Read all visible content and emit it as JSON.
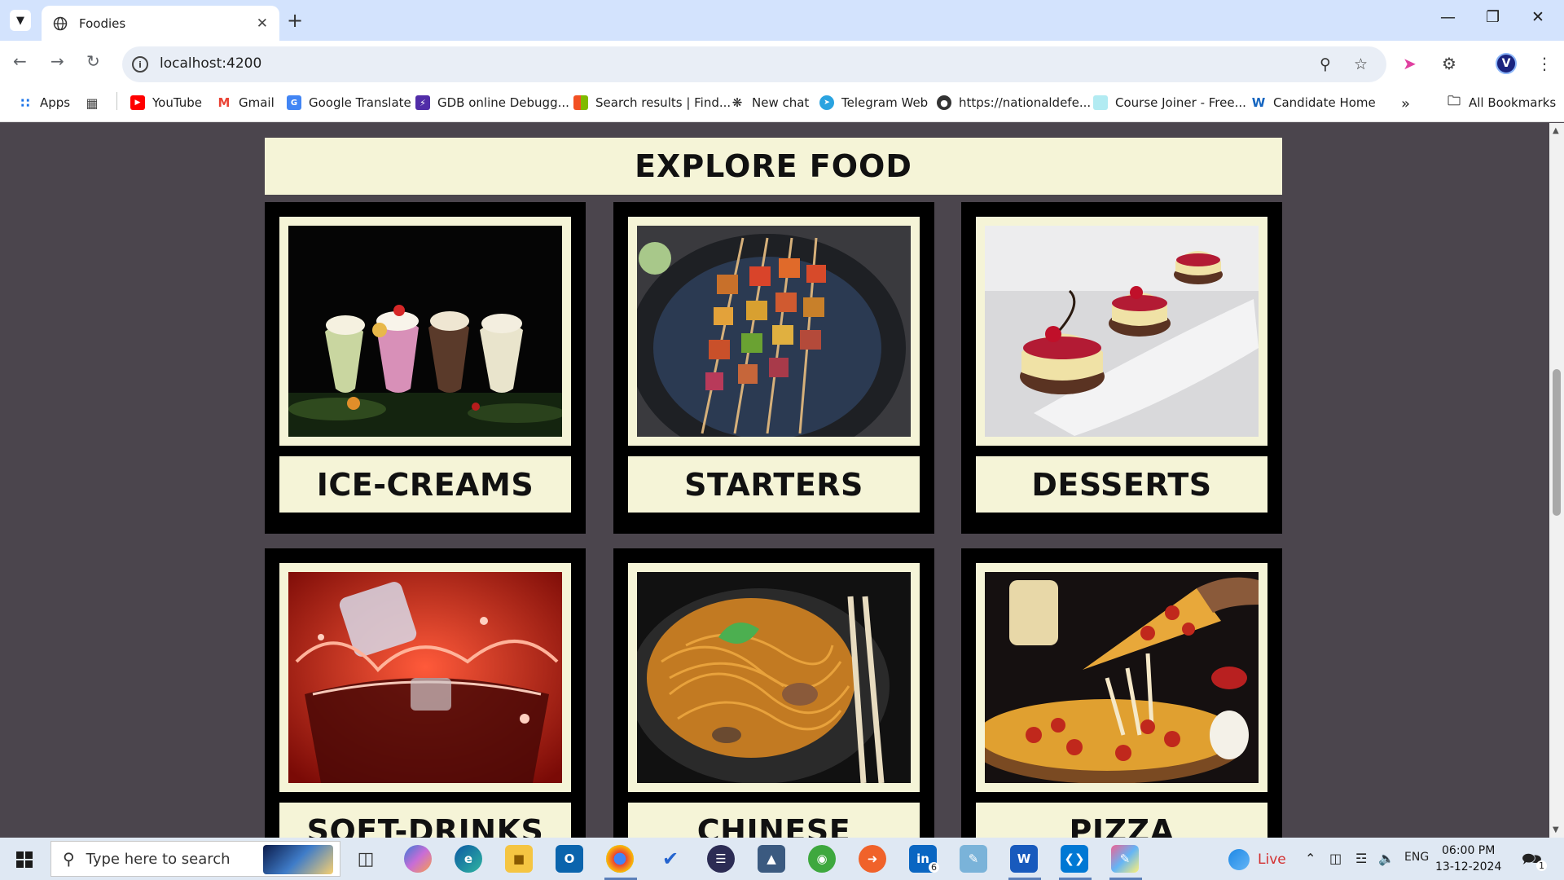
{
  "browser": {
    "tab_title": "Foodies",
    "url": "localhost:4200",
    "bookmarks": [
      {
        "label": "Apps",
        "icon": "apps-grid-icon"
      },
      {
        "label": "YouTube",
        "icon": "youtube-icon"
      },
      {
        "label": "Gmail",
        "icon": "gmail-icon"
      },
      {
        "label": "Google Translate",
        "icon": "translate-icon"
      },
      {
        "label": "GDB online Debugg...",
        "icon": "gdb-icon"
      },
      {
        "label": "Search results | Find...",
        "icon": "microsoft-icon"
      },
      {
        "label": "New chat",
        "icon": "chatgpt-icon"
      },
      {
        "label": "Telegram Web",
        "icon": "telegram-icon"
      },
      {
        "label": "https://nationaldefe...",
        "icon": "globe-icon"
      },
      {
        "label": "Course Joiner - Free...",
        "icon": "course-icon"
      },
      {
        "label": "Candidate Home",
        "icon": "candidate-icon"
      }
    ],
    "all_bookmarks": "All Bookmarks",
    "profile_initial": "V"
  },
  "page": {
    "heading": "EXPLORE FOOD",
    "categories": [
      {
        "label": "ICE-CREAMS",
        "image": "milkshake-glasses"
      },
      {
        "label": "STARTERS",
        "image": "paneer-tikka-skewers"
      },
      {
        "label": "DESSERTS",
        "image": "cherry-cheesecake-bites"
      },
      {
        "label": "SOFT-DRINKS",
        "image": "cola-ice-splash"
      },
      {
        "label": "CHINESE",
        "image": "noodles-chopsticks"
      },
      {
        "label": "PIZZA",
        "image": "pepperoni-pizza-slice"
      }
    ],
    "colors": {
      "background": "#4b454d",
      "card": "#000000",
      "panel": "#f5f4d7"
    }
  },
  "taskbar": {
    "search_placeholder": "Type here to search",
    "live_label": "Live",
    "language": "ENG",
    "time": "06:00 PM",
    "date": "13-12-2024",
    "linkedin_badge": "6",
    "notification_count": "1"
  }
}
